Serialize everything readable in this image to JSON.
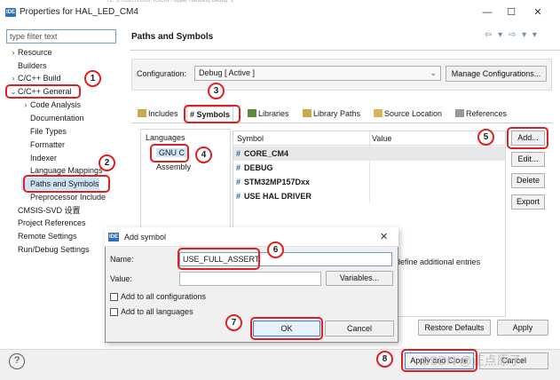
{
  "window": {
    "title": "Properties for HAL_LED_CM4",
    "top_stripe_text": "TE   “2 HSEH LOOF R5CIN Fopper Handling Debug *2"
  },
  "left": {
    "filter_placeholder": "type filter text",
    "tree": [
      {
        "label": "Resource",
        "twisty": "›"
      },
      {
        "label": "Builders",
        "twisty": ""
      },
      {
        "label": "C/C++ Build",
        "twisty": "›"
      },
      {
        "label": "C/C++ General",
        "twisty": "⌄"
      },
      {
        "label": "Code Analysis",
        "twisty": "›"
      },
      {
        "label": "Documentation",
        "twisty": ""
      },
      {
        "label": "File Types",
        "twisty": ""
      },
      {
        "label": "Formatter",
        "twisty": ""
      },
      {
        "label": "Indexer",
        "twisty": ""
      },
      {
        "label": "Language Mappings",
        "twisty": ""
      },
      {
        "label": "Paths and Symbols",
        "twisty": ""
      },
      {
        "label": "Preprocessor Include",
        "twisty": ""
      },
      {
        "label": "CMSIS-SVD 设置",
        "twisty": ""
      },
      {
        "label": "Project References",
        "twisty": ""
      },
      {
        "label": "Remote Settings",
        "twisty": ""
      },
      {
        "label": "Run/Debug Settings",
        "twisty": ""
      }
    ]
  },
  "page": {
    "title": "Paths and Symbols",
    "nav_icons": "⇦ ▾ ⇨ ▾ ▾",
    "config_label": "Configuration:",
    "config_value": "Debug  [ Active ]",
    "manage_button": "Manage Configurations...",
    "tabs": [
      "Includes",
      "# Symbols",
      "Libraries",
      "Library Paths",
      "Source Location",
      "References"
    ],
    "languages_title": "Languages",
    "languages": [
      "GNU C",
      "Assembly"
    ],
    "symbol_col": "Symbol",
    "value_col": "Value",
    "symbols": [
      "CORE_CM4",
      "DEBUG",
      "STM32MP157Dxx",
      "USE HAL DRIVER"
    ],
    "buttons": {
      "add": "Add...",
      "edit": "Edit...",
      "delete": "Delete",
      "export": "Export"
    },
    "define_text": "define additional entries",
    "restore": "Restore Defaults",
    "apply": "Apply",
    "apply_close": "Apply and Close",
    "cancel": "Cancel",
    "help": "?"
  },
  "dialog": {
    "title": "Add symbol",
    "name_label": "Name:",
    "name_value": "USE_FULL_ASSERT",
    "value_label": "Value:",
    "value_value": "",
    "variables_button": "Variables...",
    "check_all_configs": "Add to all configurations",
    "check_all_languages": "Add to all languages",
    "ok": "OK",
    "cancel": "Cancel"
  },
  "badges": [
    "1",
    "2",
    "3",
    "4",
    "5",
    "6",
    "7",
    "8"
  ],
  "watermark": "CSDN @正点原子",
  "colors": {
    "annotation": "#e02020",
    "selection": "#cce3f7",
    "symbol_hash": "#2c5aa0"
  }
}
